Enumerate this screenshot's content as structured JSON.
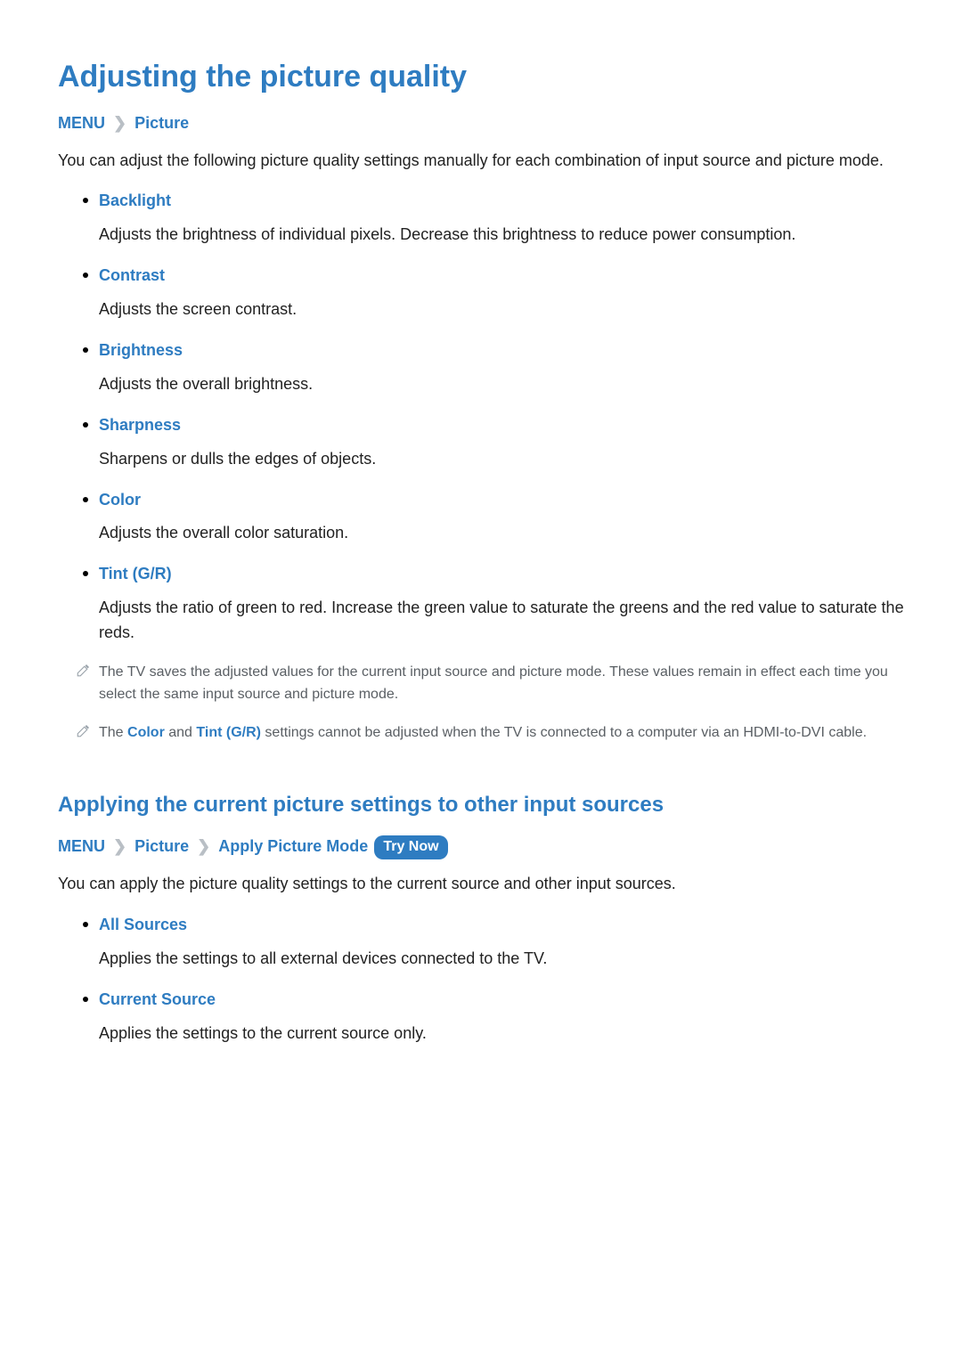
{
  "pageTitle": "Adjusting the picture quality",
  "bc1": {
    "menu": "MENU",
    "picture": "Picture"
  },
  "intro": "You can adjust the following picture quality settings manually for each combination of input source and picture mode.",
  "settings": [
    {
      "title": "Backlight",
      "desc": "Adjusts the brightness of individual pixels. Decrease this brightness to reduce power consumption."
    },
    {
      "title": "Contrast",
      "desc": "Adjusts the screen contrast."
    },
    {
      "title": "Brightness",
      "desc": "Adjusts the overall brightness."
    },
    {
      "title": "Sharpness",
      "desc": "Sharpens or dulls the edges of objects."
    },
    {
      "title": "Color",
      "desc": "Adjusts the overall color saturation."
    },
    {
      "title": "Tint (G/R)",
      "desc": "Adjusts the ratio of green to red. Increase the green value to saturate the greens and the red value to saturate the reds."
    }
  ],
  "note1": "The TV saves the adjusted values for the current input source and picture mode. These values remain in effect each time you select the same input source and picture mode.",
  "note2": {
    "pre": "The ",
    "kw1": "Color",
    "mid": " and ",
    "kw2": "Tint (G/R)",
    "post": " settings cannot be adjusted when the TV is connected to a computer via an HDMI-to-DVI cable."
  },
  "section2": {
    "title": "Applying the current picture settings to other input sources",
    "bc": {
      "menu": "MENU",
      "picture": "Picture",
      "apply": "Apply Picture Mode",
      "tryNow": "Try Now"
    },
    "intro": "You can apply the picture quality settings to the current source and other input sources.",
    "items": [
      {
        "title": "All Sources",
        "desc": "Applies the settings to all external devices connected to the TV."
      },
      {
        "title": "Current Source",
        "desc": "Applies the settings to the current source only."
      }
    ]
  },
  "glyphs": {
    "chevron": "❯"
  }
}
